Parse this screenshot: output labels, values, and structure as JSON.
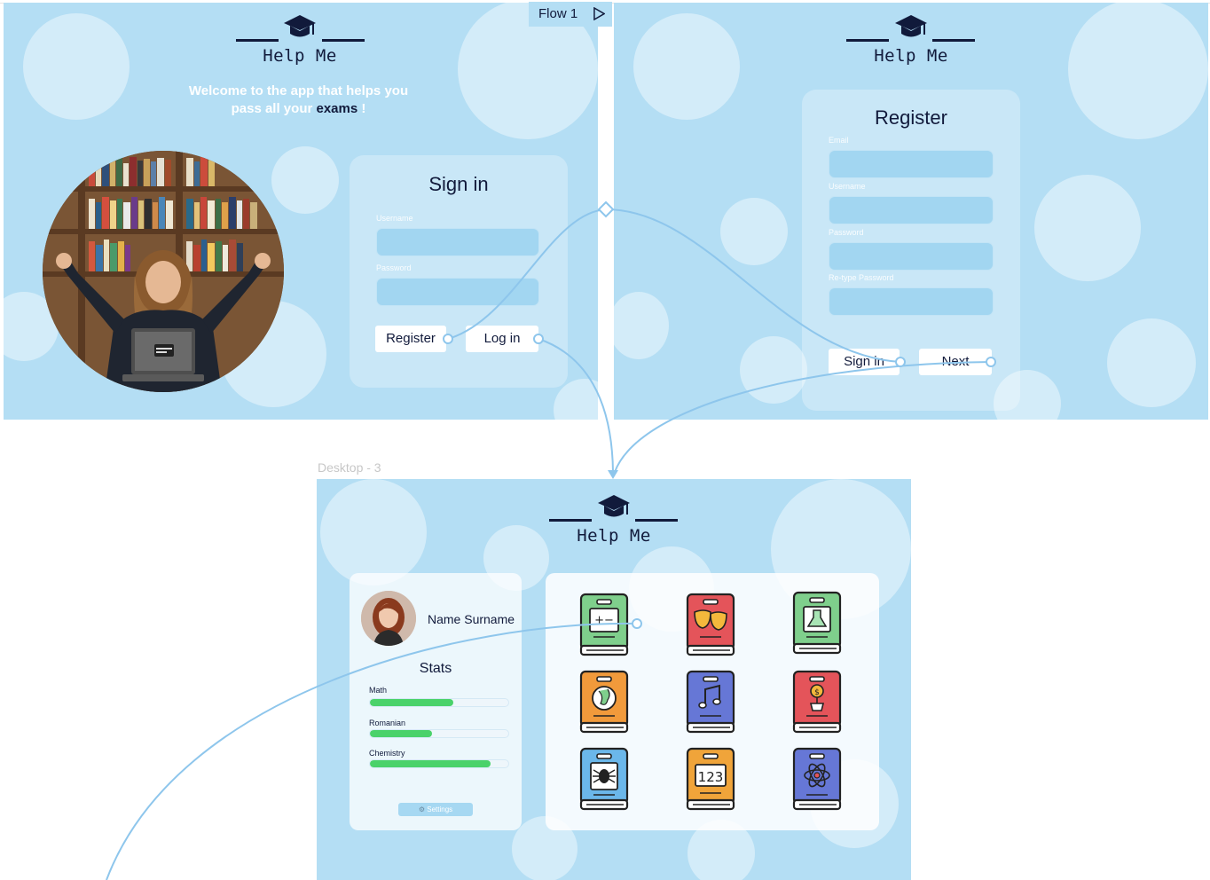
{
  "flow": {
    "label": "Flow 1"
  },
  "frame3_label": "Desktop - 3",
  "logo": {
    "text": "Help Me"
  },
  "colors": {
    "frame_bg": "#b4def4",
    "ink": "#111a3b",
    "accent_green": "#4ad26a",
    "wire": "#8ec6ec"
  },
  "signin_screen": {
    "welcome_line1": "Welcome to the app that helps you",
    "welcome_line2_prefix": "pass all your",
    "welcome_highlight": "exams",
    "welcome_suffix": "!",
    "title": "Sign in",
    "username_label": "Username",
    "password_label": "Password",
    "register_button": "Register",
    "login_button": "Log in"
  },
  "register_screen": {
    "title": "Register",
    "email_label": "Email",
    "username_label": "Username",
    "password_label": "Password",
    "retype_label": "Re-type Password",
    "signin_button": "Sign in",
    "next_button": "Next"
  },
  "dashboard": {
    "user_name": "Name Surname",
    "stats_title": "Stats",
    "stats": [
      {
        "label": "Math",
        "progress": 0.6
      },
      {
        "label": "Romanian",
        "progress": 0.45
      },
      {
        "label": "Chemistry",
        "progress": 0.87
      }
    ],
    "settings_button": "Settings",
    "books": [
      {
        "icon": "calculator-book-icon",
        "color": "#7fcf8c"
      },
      {
        "icon": "theater-masks-book-icon",
        "color": "#e4545a"
      },
      {
        "icon": "chemistry-flask-book-icon",
        "color": "#7fcf8c"
      },
      {
        "icon": "globe-book-icon",
        "color": "#f19a3b"
      },
      {
        "icon": "music-note-book-icon",
        "color": "#6677d6"
      },
      {
        "icon": "money-plant-book-icon",
        "color": "#e4545a"
      },
      {
        "icon": "bug-biology-book-icon",
        "color": "#6bb7ea"
      },
      {
        "icon": "numbers-123-book-icon",
        "color": "#f0a43a"
      },
      {
        "icon": "atom-physics-book-icon",
        "color": "#6677d6"
      }
    ]
  }
}
